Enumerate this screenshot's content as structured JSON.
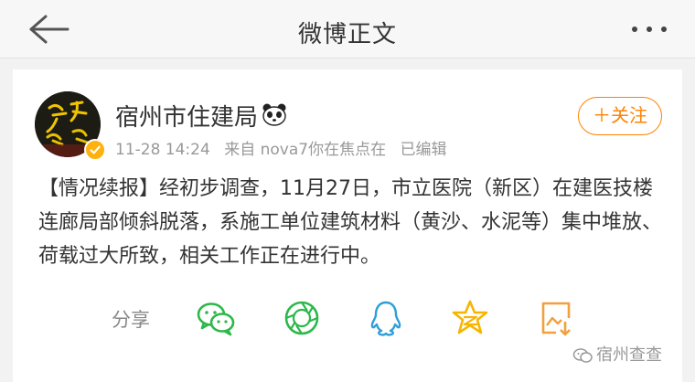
{
  "navbar": {
    "title": "微博正文",
    "back_icon": "arrow-left-icon",
    "more_icon": "more-dots-icon"
  },
  "post": {
    "username": "宿州市住建局",
    "name_emoji": "panda-icon",
    "avatar_icon": "avatar-calligraphy-icon",
    "verified_icon": "verified-badge-icon",
    "time": "11-28 14:24",
    "source": "来自 nova7你在焦点在",
    "edited": "已编辑",
    "follow_label": "＋关注",
    "text": "【情况续报】经初步调查，11月27日，市立医院（新区）在建医技楼连廊局部倾斜脱落，系施工单位建筑材料（黄沙、水泥等）集中堆放、荷载过大所致，相关工作正在进行中。"
  },
  "share": {
    "label": "分享",
    "targets": [
      {
        "name": "wechat",
        "icon": "wechat-icon"
      },
      {
        "name": "moments",
        "icon": "wechat-moments-icon"
      },
      {
        "name": "qq",
        "icon": "qq-icon"
      },
      {
        "name": "qzone",
        "icon": "qzone-star-icon"
      },
      {
        "name": "save-image",
        "icon": "save-image-icon"
      }
    ]
  },
  "watermark": {
    "text": "宿州查查",
    "icon": "wechat-official-account-icon"
  },
  "colors": {
    "accent_orange": "#ff8200",
    "wechat_green": "#2cb84a",
    "qq_blue": "#2e9fd8",
    "qzone_yellow": "#f7b500",
    "save_orange": "#f2a03b",
    "meta_gray": "#999999"
  }
}
